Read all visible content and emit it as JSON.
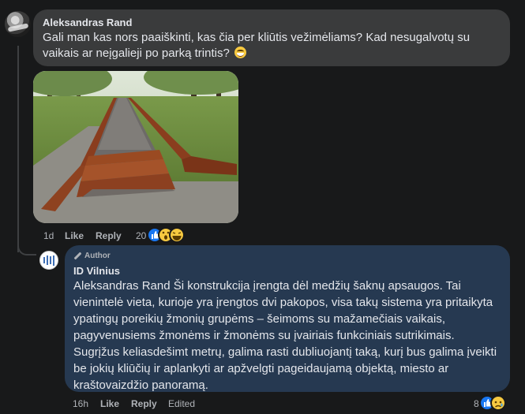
{
  "comment1": {
    "author": "Aleksandras Rand",
    "text": "Gali man kas nors paaiškinti, kas čia per kliūtis vežimėliams? Kad nesugalvotų su vaikais ar neįgalieji po parką trintis?",
    "emoji": "grinning-sweat-emoji",
    "time": "1d",
    "like_label": "Like",
    "reply_label": "Reply",
    "reaction_count": "20",
    "reactions": [
      "like",
      "wow",
      "haha"
    ]
  },
  "photo": {
    "description_icon": "photo"
  },
  "reply": {
    "badge": "Author",
    "author": "ID Vilnius",
    "text": "Aleksandras Rand Ši konstrukcija įrengta dėl medžių šaknų apsaugos. Tai vienintelė vieta, kurioje yra įrengtos dvi pakopos, visa takų sistema yra pritaikyta ypatingų poreikių žmonių grupėms – šeimoms su mažamečiais vaikais, pagyvenusiems žmonėms ir žmonėms su įvairiais funkciniais sutrikimais. Sugrįžus keliasdešimt metrų, galima rasti dubliuojantį taką, kurį bus galima įveikti be jokių kliūčių ir aplankyti ar apžvelgti pageidaujamą objektą, miesto ar kraštovaizdžio panoramą.",
    "time": "16h",
    "like_label": "Like",
    "reply_label": "Reply",
    "edited_label": "Edited",
    "reaction_count": "8",
    "reactions": [
      "like",
      "sad"
    ]
  },
  "colors": {
    "bg": "#18191a",
    "bubble": "#3a3b3c",
    "author_bubble": "#263951",
    "like_blue": "#1877f2",
    "emoji_yellow": "#f7c940"
  }
}
